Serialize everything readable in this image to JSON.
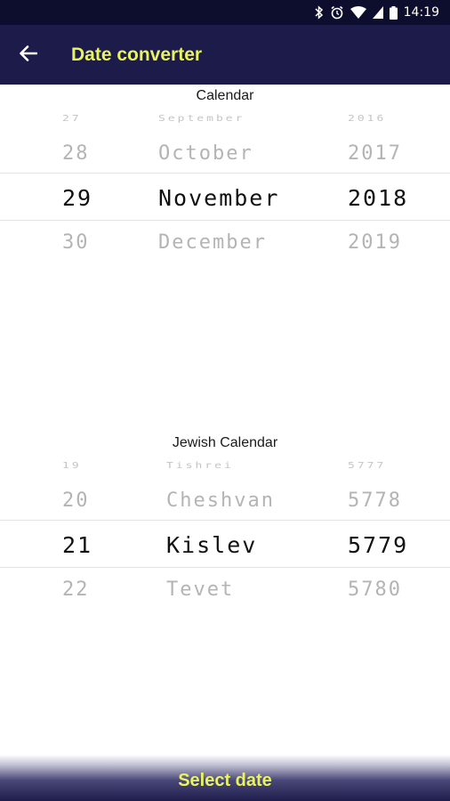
{
  "status_bar": {
    "time": "14:19"
  },
  "app_bar": {
    "title": "Date converter"
  },
  "calendar": {
    "label": "Calendar",
    "day": [
      "27",
      "28",
      "29",
      "30"
    ],
    "month": [
      "September",
      "October",
      "November",
      "December"
    ],
    "year": [
      "2016",
      "2017",
      "2018",
      "2019"
    ]
  },
  "jewish_calendar": {
    "label": "Jewish Calendar",
    "day": [
      "19",
      "20",
      "21",
      "22"
    ],
    "month": [
      "Tishrei",
      "Cheshvan",
      "Kislev",
      "Tevet"
    ],
    "year": [
      "5777",
      "5778",
      "5779",
      "5780"
    ]
  },
  "footer": {
    "select_label": "Select date"
  },
  "colors": {
    "primary": "#1c1b4a",
    "accent": "#e8f35e",
    "status_bar": "#0d0d2e"
  },
  "icons": [
    "bluetooth-icon",
    "alarm-icon",
    "wifi-icon",
    "signal-icon",
    "battery-icon",
    "back-arrow-icon"
  ]
}
